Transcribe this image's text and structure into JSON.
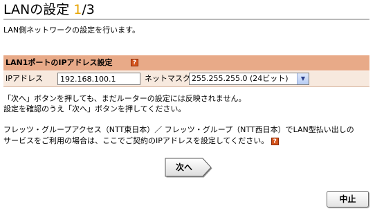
{
  "page": {
    "title_prefix": "LANの設定 ",
    "title_step": "1",
    "title_suffix": "/3",
    "intro": "LAN側ネットワークの設定を行います。"
  },
  "section": {
    "header": "LAN1ポートのIPアドレス設定",
    "help_icon": "?",
    "ip_label": "IPアドレス",
    "ip_value": "192.168.100.1",
    "mask_label": "ネットマスク",
    "mask_selected": "255.255.255.0 (24ビット)"
  },
  "notes": {
    "line1": "「次へ」ボタンを押しても、まだルーターの設定には反映されません。",
    "line2": "設定を確認のうえ「次へ」ボタンを押してください。",
    "line3": "フレッツ・グループアクセス（NTT東日本）／ フレッツ・グループ（NTT西日本）でLAN型払い出しの",
    "line4": "サービスをご利用の場合は、ここでご契約のIPアドレスを設定してください。"
  },
  "buttons": {
    "next": "次へ",
    "cancel": "中止"
  },
  "colors": {
    "step_accent": "#e8a400",
    "section_header_bg": "#e8aa88",
    "row_bg": "#f7e9de",
    "help_icon_bg": "#d4541c"
  }
}
